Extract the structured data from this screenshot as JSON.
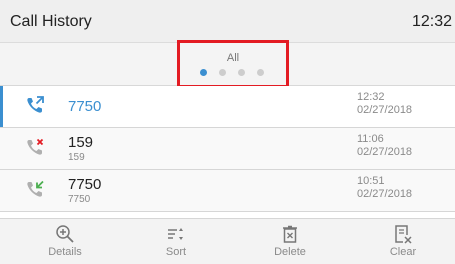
{
  "header": {
    "title": "Call History",
    "time": "12:32"
  },
  "page": {
    "label": "All",
    "dots": [
      true,
      false,
      false,
      false
    ]
  },
  "calls": [
    {
      "name": "7750",
      "number": "",
      "time": "12:32",
      "date": "02/27/2018",
      "type": "outgoing"
    },
    {
      "name": "159",
      "number": "159",
      "time": "11:06",
      "date": "02/27/2018",
      "type": "missed"
    },
    {
      "name": "7750",
      "number": "7750",
      "time": "10:51",
      "date": "02/27/2018",
      "type": "incoming"
    }
  ],
  "toolbar": {
    "details": "Details",
    "sort": "Sort",
    "delete": "Delete",
    "clear": "Clear"
  },
  "colors": {
    "accent": "#3b8fd0",
    "highlight_box": "#e31b23",
    "missed": "#e31b23",
    "incoming": "#4caf50"
  }
}
